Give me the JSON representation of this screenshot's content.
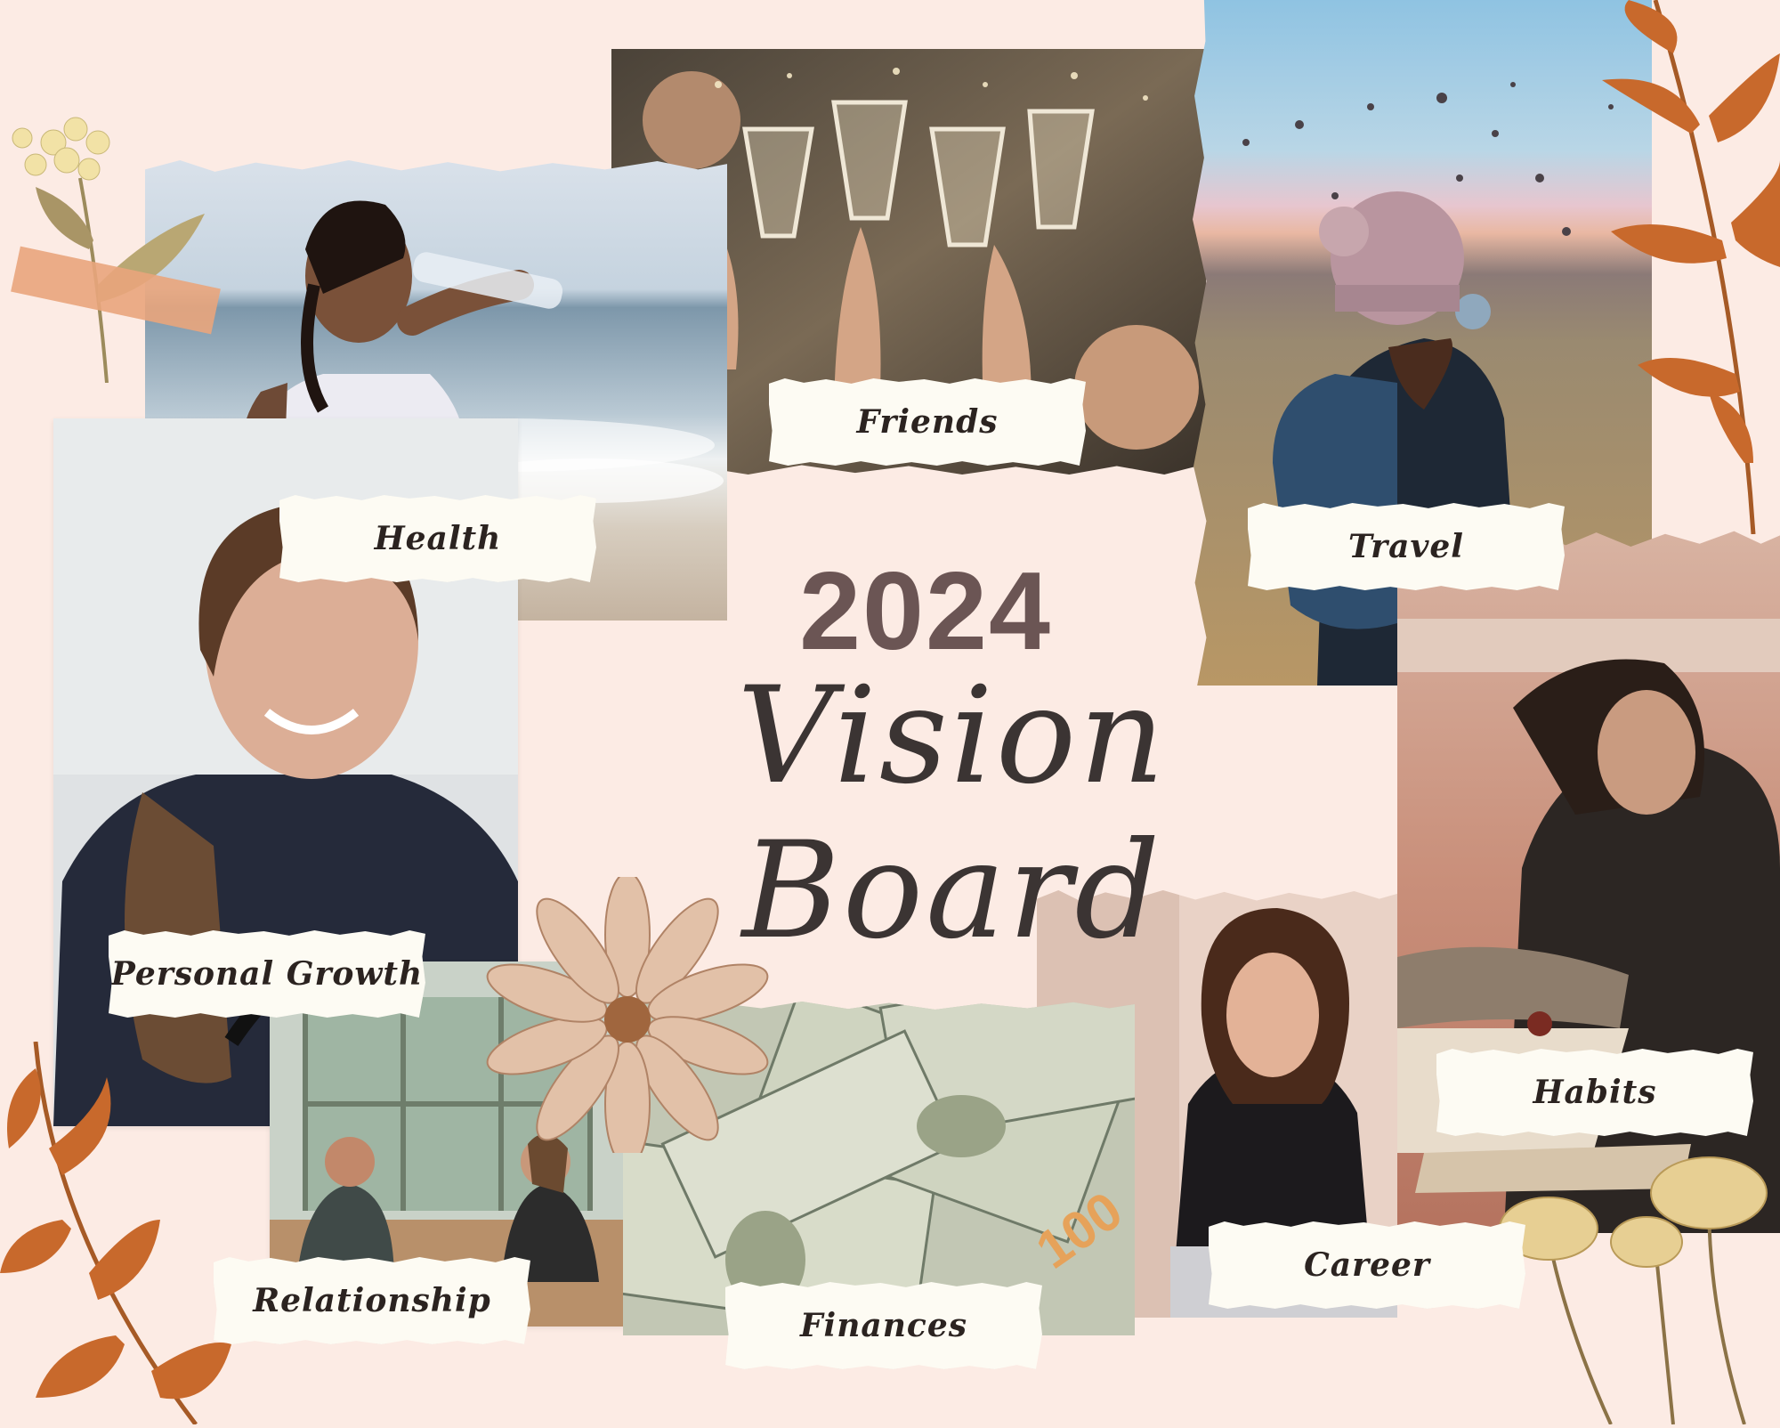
{
  "title": {
    "year": "2024",
    "script": "Vision Board"
  },
  "labels": {
    "health": "Health",
    "friends": "Friends",
    "travel": "Travel",
    "personal_growth": "Personal Growth",
    "relationship": "Relationship",
    "finances": "Finances",
    "career": "Career",
    "habits": "Habits"
  },
  "colors": {
    "background": "#fcebe4",
    "title_year": "#6b5554",
    "title_script": "#3b3433",
    "label_bg": "#fdfbf3",
    "leaf_orange": "#c8692c"
  }
}
